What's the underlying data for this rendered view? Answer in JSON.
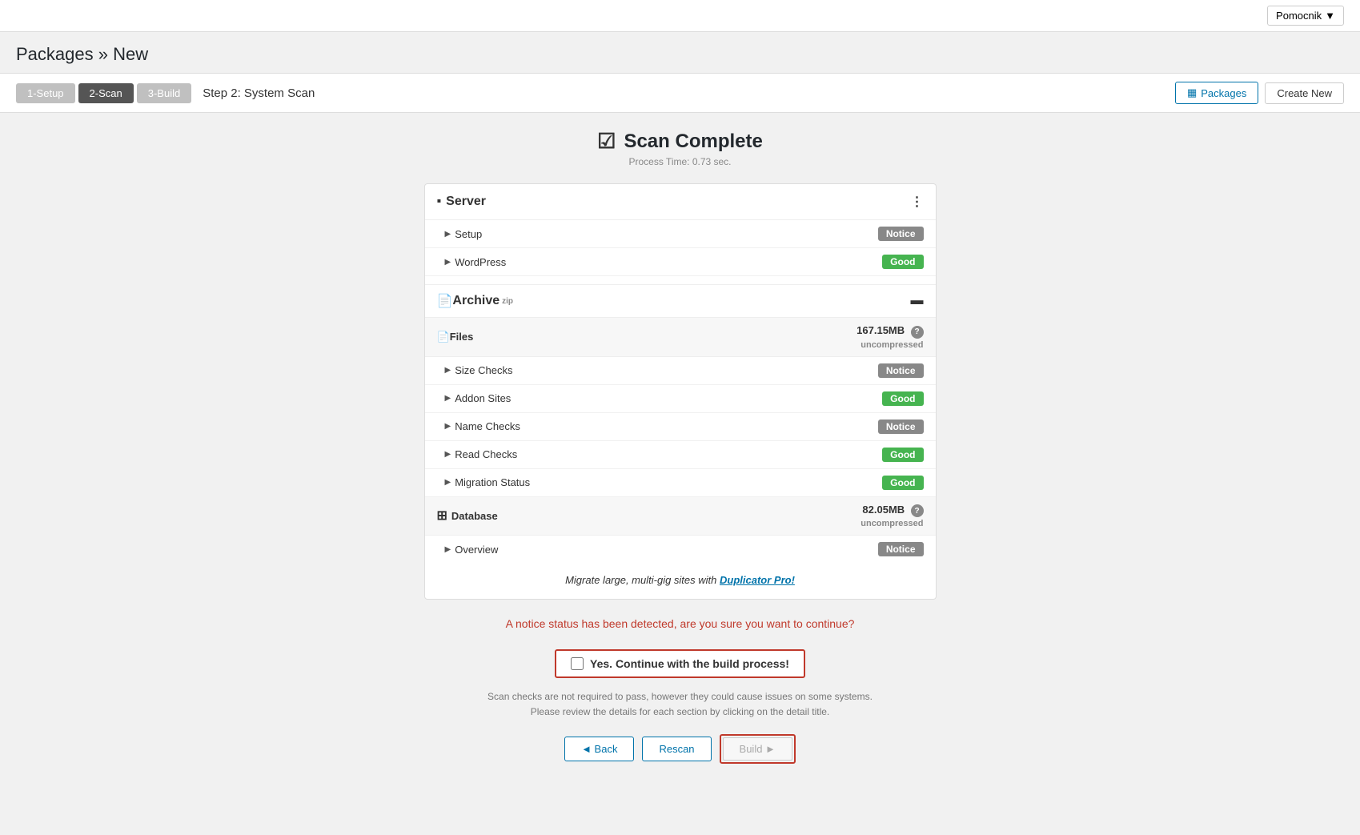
{
  "topbar": {
    "pomocnik_label": "Pomocnik",
    "chevron": "▼"
  },
  "page": {
    "title": "Packages » New"
  },
  "steps": {
    "step1_label": "1-Setup",
    "step2_label": "2-Scan",
    "step3_label": "3-Build",
    "current_step": "Step 2: System Scan",
    "packages_btn": "Packages",
    "create_new_btn": "Create New"
  },
  "scan": {
    "title": "Scan Complete",
    "process_time": "Process Time: 0.73 sec."
  },
  "server_section": {
    "title": "Server",
    "items": [
      {
        "label": "Setup",
        "badge": "Notice",
        "badge_type": "notice"
      },
      {
        "label": "WordPress",
        "badge": "Good",
        "badge_type": "good"
      }
    ]
  },
  "archive_section": {
    "title": "Archive",
    "format": "zip",
    "files_label": "Files",
    "files_size": "167.15MB",
    "files_size_note": "uncompressed",
    "file_items": [
      {
        "label": "Size Checks",
        "badge": "Notice",
        "badge_type": "notice"
      },
      {
        "label": "Addon Sites",
        "badge": "Good",
        "badge_type": "good"
      },
      {
        "label": "Name Checks",
        "badge": "Notice",
        "badge_type": "notice"
      },
      {
        "label": "Read Checks",
        "badge": "Good",
        "badge_type": "good"
      },
      {
        "label": "Migration Status",
        "badge": "Good",
        "badge_type": "good"
      }
    ],
    "db_label": "Database",
    "db_size": "82.05MB",
    "db_size_note": "uncompressed",
    "db_items": [
      {
        "label": "Overview",
        "badge": "Notice",
        "badge_type": "notice"
      }
    ]
  },
  "promo": {
    "text": "Migrate large, multi-gig sites with ",
    "link": "Duplicator Pro!"
  },
  "confirmation": {
    "warning_text": "A notice status has been detected, are you sure you want to continue?",
    "checkbox_label": "Yes. Continue with the build process!",
    "note_line1": "Scan checks are not required to pass, however they could cause issues on some systems.",
    "note_line2": "Please review the details for each section by clicking on the detail title."
  },
  "buttons": {
    "back": "◄ Back",
    "rescan": "Rescan",
    "build": "Build ►"
  }
}
